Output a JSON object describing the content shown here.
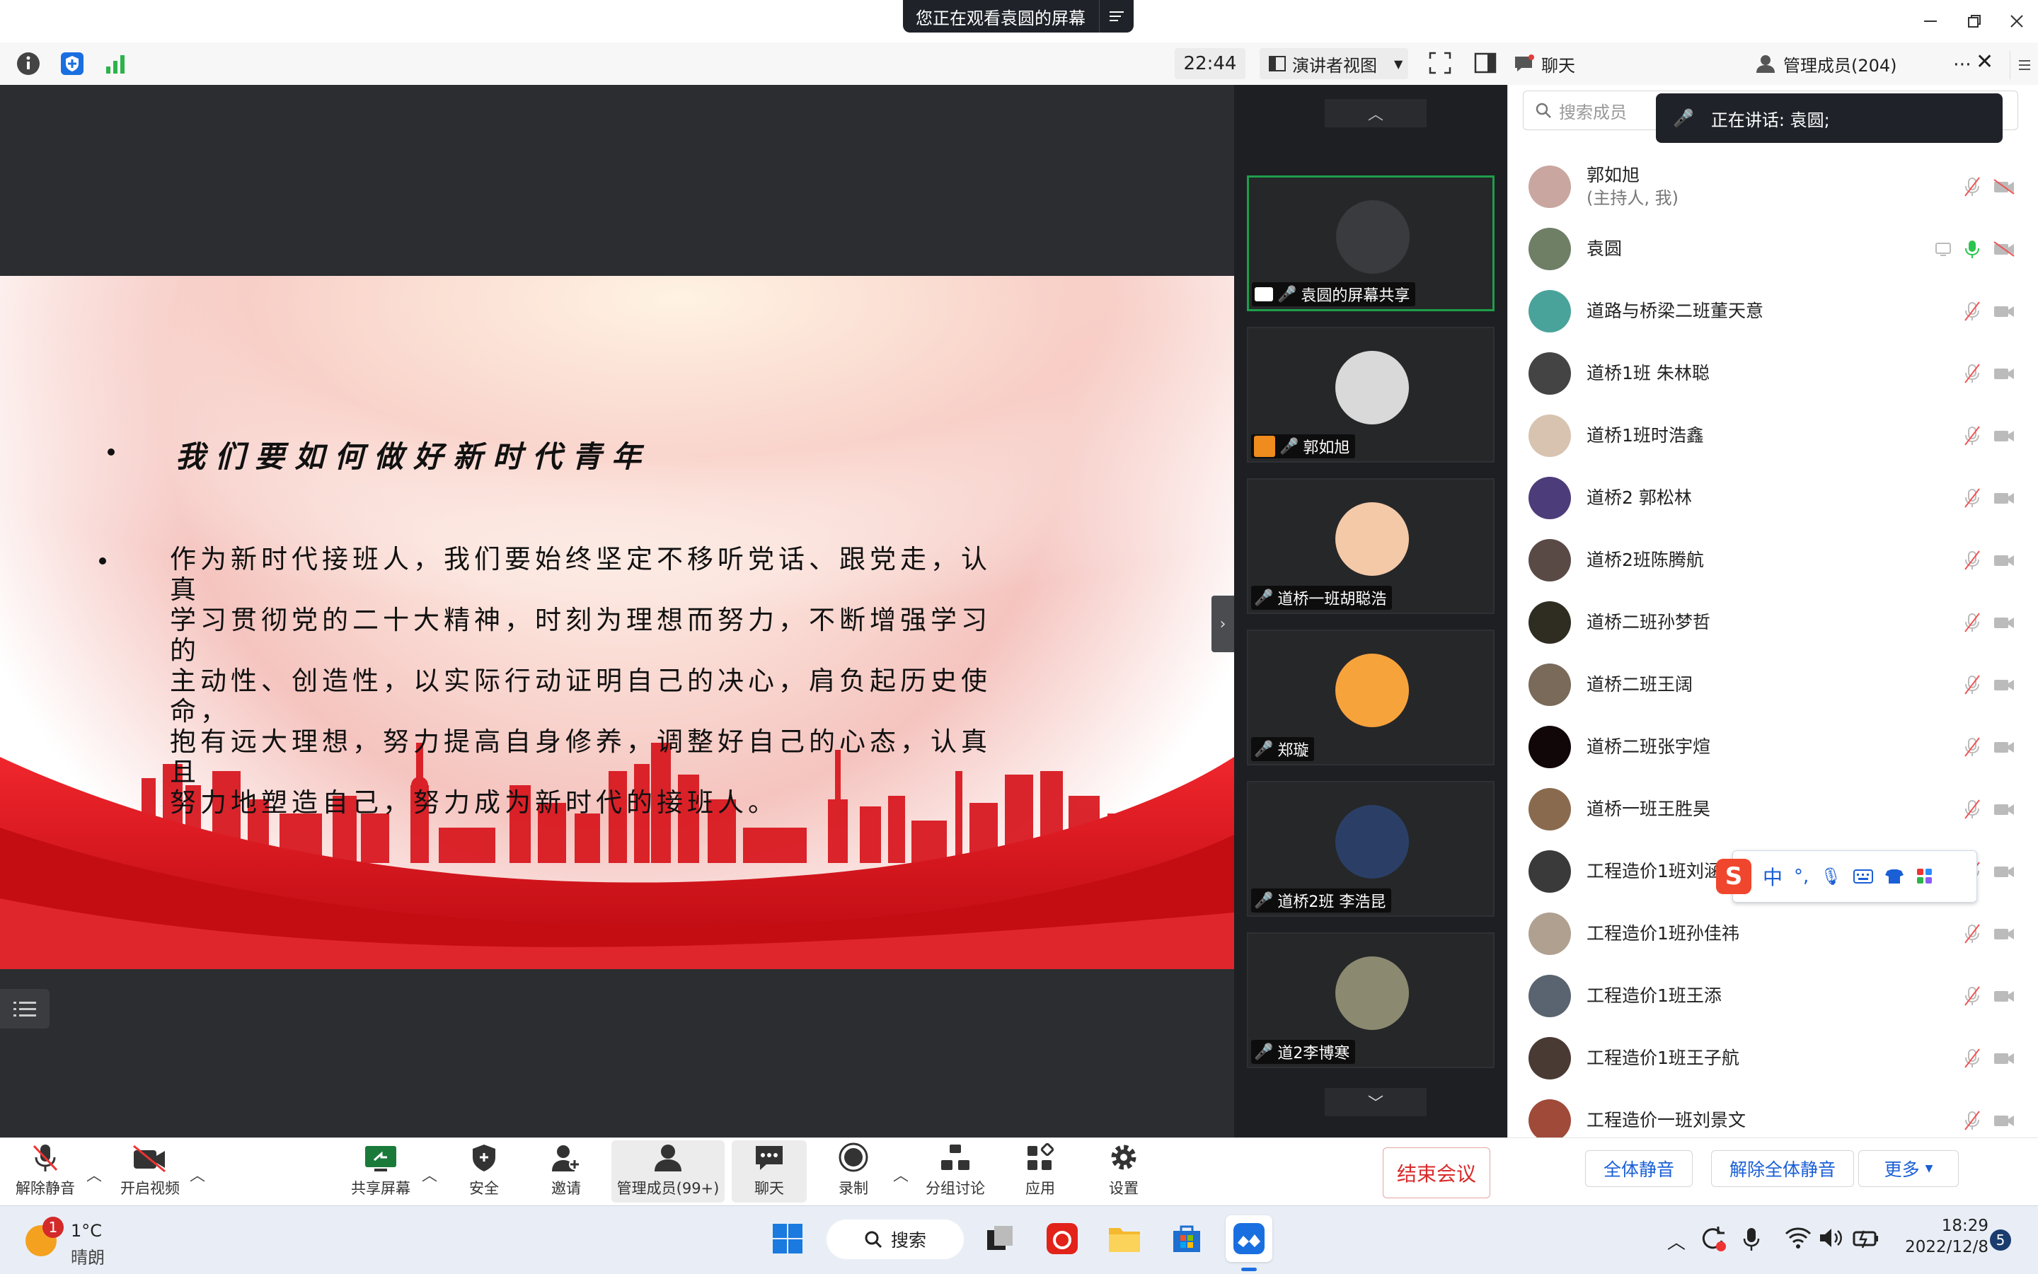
{
  "title_bar": {
    "share_banner": "您正在观看袁圆的屏幕"
  },
  "toolbar": {
    "time": "22:44",
    "view_mode": "演讲者视图"
  },
  "panel_tabs": {
    "chat": "聊天",
    "members": "管理成员(204)"
  },
  "slide": {
    "title": "我们要如何做好新时代青年",
    "body_lines": [
      "作为新时代接班人，我们要始终坚定不移听党话、跟党走，认真",
      "学习贯彻党的二十大精神，时刻为理想而努力，不断增强学习的",
      "主动性、创造性，以实际行动证明自己的决心，肩负起历史使命，",
      "抱有远大理想，努力提高自身修养，调整好自己的心态，认真且",
      "努力地塑造自己，努力成为新时代的接班人。"
    ]
  },
  "thumbnails": [
    {
      "label": "袁圆的屏幕共享",
      "color": "#3a3b3e"
    },
    {
      "label": "郭如旭",
      "color": "#d9d9d9"
    },
    {
      "label": "道桥一班胡聪浩",
      "color": "#f3c9a8"
    },
    {
      "label": "郑璇",
      "color": "#f7a33c"
    },
    {
      "label": "道桥2班 李浩昆",
      "color": "#2b3f66"
    },
    {
      "label": "道2李博寒",
      "color": "#8b8a70"
    }
  ],
  "members": {
    "search_placeholder": "搜索成员",
    "speaking": "正在讲话: 袁圆;",
    "list": [
      {
        "name": "郭如旭",
        "sub": "(主持人, 我)",
        "color": "#c9a7a0"
      },
      {
        "name": "袁圆",
        "sub": "",
        "color": "#6e7f66"
      },
      {
        "name": "道路与桥梁二班董天意",
        "sub": "",
        "color": "#4aa39a"
      },
      {
        "name": "道桥1班  朱林聪",
        "sub": "",
        "color": "#444444"
      },
      {
        "name": "道桥1班时浩鑫",
        "sub": "",
        "color": "#d8c3b0"
      },
      {
        "name": "道桥2  郭松林",
        "sub": "",
        "color": "#4d3c7a"
      },
      {
        "name": "道桥2班陈腾航",
        "sub": "",
        "color": "#5a4a46"
      },
      {
        "name": "道桥二班孙梦哲",
        "sub": "",
        "color": "#2f2d22"
      },
      {
        "name": "道桥二班王阔",
        "sub": "",
        "color": "#7a6a5a"
      },
      {
        "name": "道桥二班张宇煊",
        "sub": "",
        "color": "#120708"
      },
      {
        "name": "道桥一班王胜昊",
        "sub": "",
        "color": "#8a6a4e"
      },
      {
        "name": "工程造价1班刘涵禹",
        "sub": "",
        "color": "#3a3a3a"
      },
      {
        "name": "工程造价1班孙佳祎",
        "sub": "",
        "color": "#b0a090"
      },
      {
        "name": "工程造价1班王添",
        "sub": "",
        "color": "#5a6470"
      },
      {
        "name": "工程造价1班王子航",
        "sub": "",
        "color": "#4a3a34"
      },
      {
        "name": "工程造价一班刘景文",
        "sub": "",
        "color": "#a04a3a"
      }
    ],
    "mute_all": "全体静音",
    "unmute_all": "解除全体静音",
    "more": "更多"
  },
  "controls": {
    "unmute": "解除静音",
    "start_video": "开启视频",
    "share_screen": "共享屏幕",
    "security": "安全",
    "invite": "邀请",
    "manage_members": "管理成员(99+)",
    "chat": "聊天",
    "record": "录制",
    "breakout": "分组讨论",
    "apps": "应用",
    "settings": "设置",
    "end_meeting": "结束会议"
  },
  "ime": {
    "mode": "中"
  },
  "taskbar": {
    "weather_temp": "1°C",
    "weather_desc": "晴朗",
    "weather_badge": "1",
    "search": "搜索",
    "time": "18:29",
    "date": "2022/12/8",
    "notification_count": "5"
  },
  "colors": {
    "accent": "#1a5fd6",
    "danger": "#d92a2a",
    "active_speaker": "#1e9e4a",
    "slide_red": "#d8141c"
  }
}
